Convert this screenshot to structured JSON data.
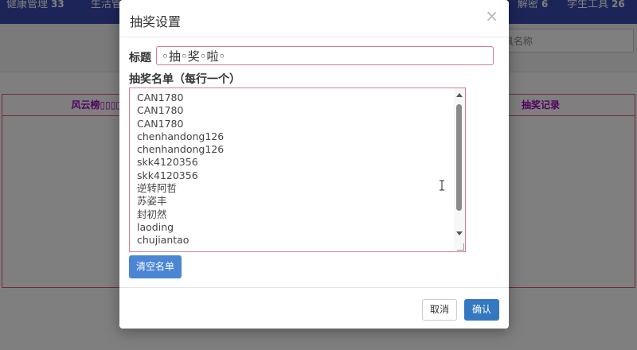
{
  "background": {
    "nav": [
      {
        "label": "健康管理",
        "count": "33"
      },
      {
        "label": "生活管",
        "count": ""
      },
      {
        "label": "解密",
        "count": "6"
      },
      {
        "label": "学生工具",
        "count": "26"
      }
    ],
    "search_placeholder": "具名称",
    "left_panel_title": "风云榜▯▯▯▯▯",
    "right_panel_title": "抽奖记录"
  },
  "modal": {
    "title": "抽奖设置",
    "close_label": "×",
    "title_label": "标题",
    "title_value": "◦抽◦奖◦啦◦",
    "list_label": "抽奖名单（每行一个）",
    "list_items": [
      "CAN1780",
      "CAN1780",
      "CAN1780",
      "chenhandong126",
      "chenhandong126",
      "skk4120356",
      "skk4120356",
      "逆转阿哲",
      "苏姿丰",
      "封初然",
      "laoding",
      "chujiantao"
    ],
    "clear_label": "清空名单",
    "cancel_label": "取消",
    "confirm_label": "确认"
  },
  "colors": {
    "accent": "#3378c0",
    "clear_button": "#4a86d4",
    "border_highlight": "#d08090"
  },
  "icons": {
    "close": "close-icon",
    "cursor": "text-cursor-icon"
  }
}
